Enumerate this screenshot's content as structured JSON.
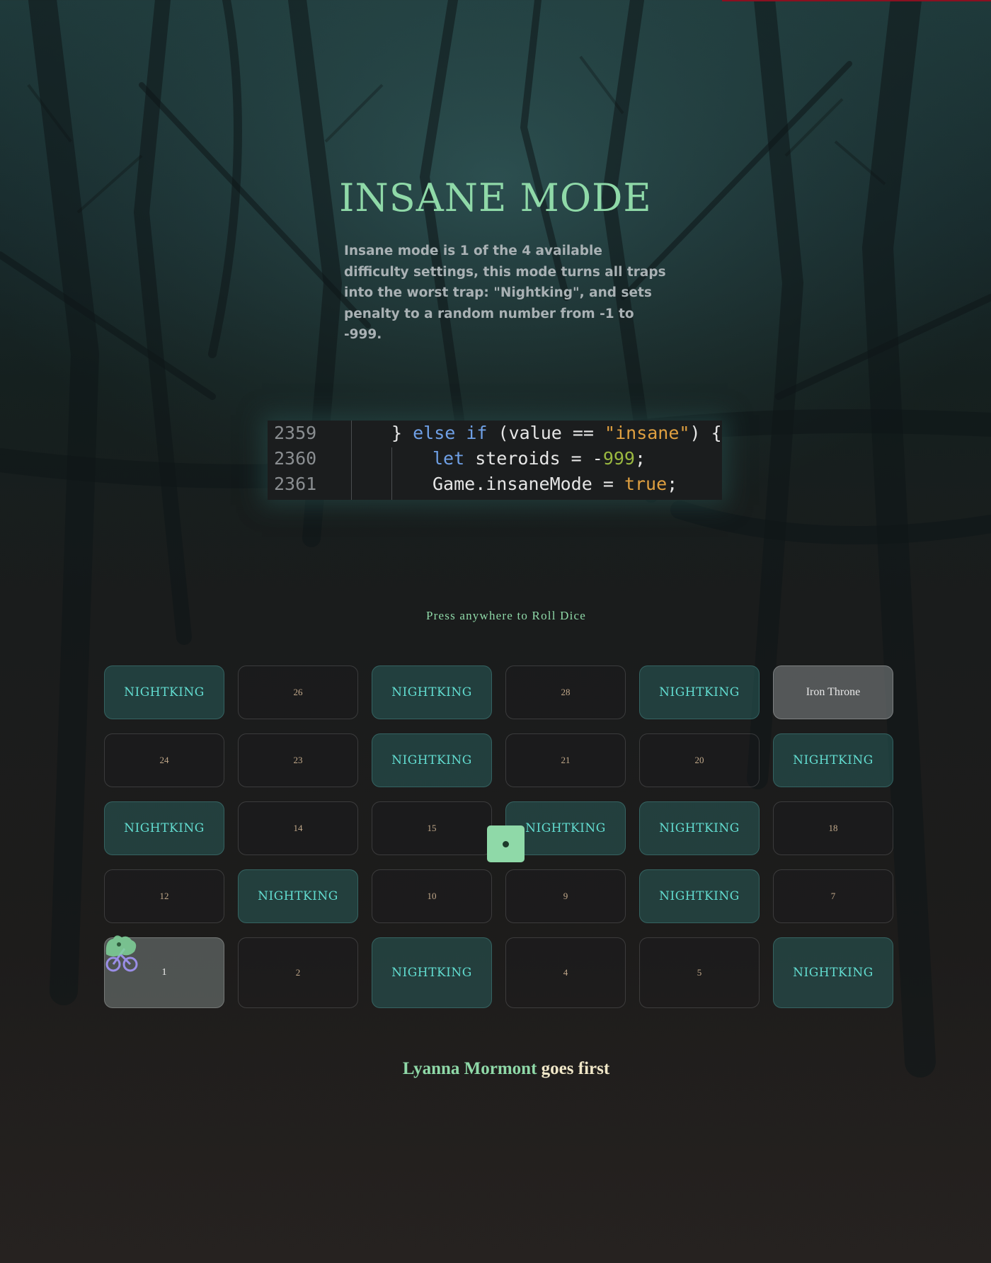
{
  "header": {
    "title": "INSANE MODE",
    "description": "Insane mode is 1 of the 4 available difficulty settings, this mode turns all traps into the worst trap: \"Nightking\", and sets penalty to a random number from -1 to -999."
  },
  "code_snippet": {
    "line_numbers": [
      "2359",
      "2360",
      "2361"
    ],
    "lines": [
      [
        "} ",
        "else if",
        " (value == ",
        "\"insane\"",
        ") {"
      ],
      [
        "let",
        " steroids = -",
        "999",
        ";"
      ],
      [
        "Game.insaneMode = ",
        "true",
        ";"
      ]
    ]
  },
  "prompt": "Press anywhere to Roll Dice",
  "board": {
    "rows": [
      [
        {
          "label": "NIGHTKING",
          "kind": "trap"
        },
        {
          "label": "26",
          "kind": "normal"
        },
        {
          "label": "NIGHTKING",
          "kind": "trap"
        },
        {
          "label": "28",
          "kind": "normal"
        },
        {
          "label": "NIGHTKING",
          "kind": "trap"
        },
        {
          "label": "Iron Throne",
          "kind": "goal"
        }
      ],
      [
        {
          "label": "24",
          "kind": "normal"
        },
        {
          "label": "23",
          "kind": "normal"
        },
        {
          "label": "NIGHTKING",
          "kind": "trap"
        },
        {
          "label": "21",
          "kind": "normal"
        },
        {
          "label": "20",
          "kind": "normal"
        },
        {
          "label": "NIGHTKING",
          "kind": "trap"
        }
      ],
      [
        {
          "label": "NIGHTKING",
          "kind": "trap"
        },
        {
          "label": "14",
          "kind": "normal"
        },
        {
          "label": "15",
          "kind": "normal"
        },
        {
          "label": "NIGHTKING",
          "kind": "trap"
        },
        {
          "label": "NIGHTKING",
          "kind": "trap"
        },
        {
          "label": "18",
          "kind": "normal"
        }
      ],
      [
        {
          "label": "12",
          "kind": "normal"
        },
        {
          "label": "NIGHTKING",
          "kind": "trap"
        },
        {
          "label": "10",
          "kind": "normal"
        },
        {
          "label": "9",
          "kind": "normal"
        },
        {
          "label": "NIGHTKING",
          "kind": "trap"
        },
        {
          "label": "7",
          "kind": "normal"
        }
      ],
      [
        {
          "label": "1",
          "kind": "start"
        },
        {
          "label": "2",
          "kind": "normal"
        },
        {
          "label": "NIGHTKING",
          "kind": "trap"
        },
        {
          "label": "4",
          "kind": "normal"
        },
        {
          "label": "5",
          "kind": "normal"
        },
        {
          "label": "NIGHTKING",
          "kind": "trap"
        }
      ]
    ]
  },
  "dice": {
    "value": 1,
    "color": "#8fd9a8"
  },
  "status": {
    "player": "Lyanna Mormont",
    "suffix": " goes first"
  },
  "colors": {
    "accent": "#8fd9a8",
    "trap_text": "#62dcd0",
    "tile_text": "#c2a98a"
  }
}
